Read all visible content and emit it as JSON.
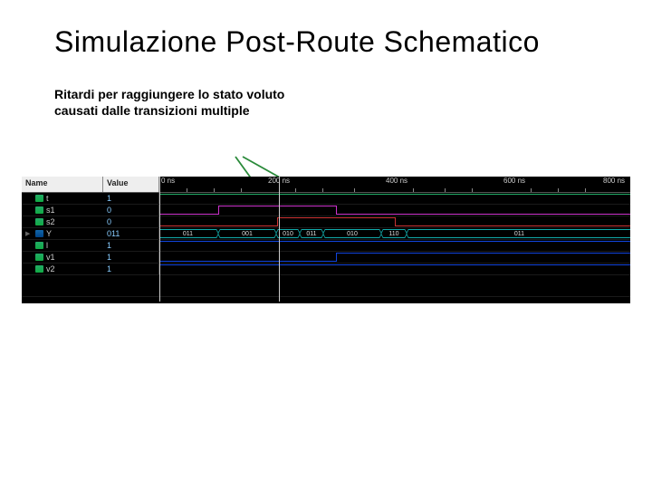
{
  "title": "Simulazione Post-Route Schematico",
  "subtitle_line1": "Ritardi per raggiungere lo stato voluto",
  "subtitle_line2": "causati dalle transizioni multiple",
  "columns": {
    "name": "Name",
    "value": "Value"
  },
  "time_ticks": [
    "0 ns",
    "200 ns",
    "400 ns",
    "600 ns",
    "800 ns"
  ],
  "signals": [
    {
      "name": "t",
      "value": "1",
      "icon": "sig",
      "expand": ""
    },
    {
      "name": "s1",
      "value": "0",
      "icon": "sig",
      "expand": ""
    },
    {
      "name": "s2",
      "value": "0",
      "icon": "sig",
      "expand": ""
    },
    {
      "name": "Y",
      "value": "011",
      "icon": "bus",
      "expand": "▶"
    },
    {
      "name": "l",
      "value": "1",
      "icon": "sig",
      "expand": ""
    },
    {
      "name": "v1",
      "value": "1",
      "icon": "sig",
      "expand": ""
    },
    {
      "name": "v2",
      "value": "1",
      "icon": "sig",
      "expand": ""
    }
  ],
  "bus_values": [
    "011",
    "001",
    "010",
    "011",
    "010",
    "110",
    "011"
  ],
  "icons": {
    "sig": "signal-scalar-icon",
    "bus": "signal-bus-icon"
  }
}
